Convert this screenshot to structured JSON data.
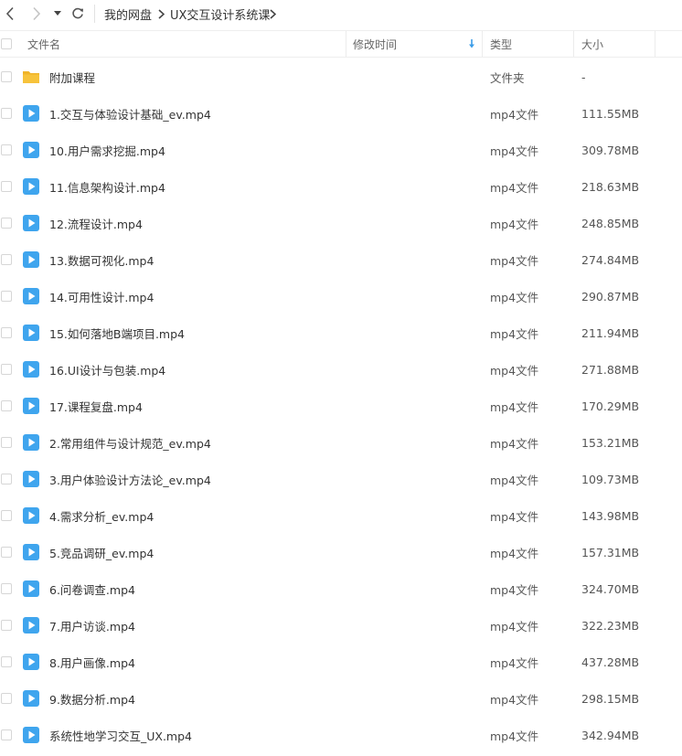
{
  "toolbar": {
    "back_icon": "chevron-left-icon",
    "forward_icon": "chevron-right-icon",
    "dropdown_icon": "caret-down-icon",
    "refresh_icon": "refresh-icon"
  },
  "breadcrumb": {
    "items": [
      "我的网盘",
      "UX交互设计系统课"
    ]
  },
  "columns": {
    "name": "文件名",
    "modified": "修改时间",
    "type": "类型",
    "size": "大小",
    "sort_icon": "sort-down-arrow-icon"
  },
  "colors": {
    "accent": "#3b9ce8",
    "folder": "#f7c33b",
    "video": "#3fa5ee"
  },
  "files": [
    {
      "name": "附加课程",
      "type": "文件夹",
      "size": "-",
      "icon": "folder-icon"
    },
    {
      "name": "1.交互与体验设计基础_ev.mp4",
      "type": "mp4文件",
      "size": "111.55MB",
      "icon": "video-file-icon"
    },
    {
      "name": "10.用户需求挖掘.mp4",
      "type": "mp4文件",
      "size": "309.78MB",
      "icon": "video-file-icon"
    },
    {
      "name": "11.信息架构设计.mp4",
      "type": "mp4文件",
      "size": "218.63MB",
      "icon": "video-file-icon"
    },
    {
      "name": "12.流程设计.mp4",
      "type": "mp4文件",
      "size": "248.85MB",
      "icon": "video-file-icon"
    },
    {
      "name": "13.数据可视化.mp4",
      "type": "mp4文件",
      "size": "274.84MB",
      "icon": "video-file-icon"
    },
    {
      "name": "14.可用性设计.mp4",
      "type": "mp4文件",
      "size": "290.87MB",
      "icon": "video-file-icon"
    },
    {
      "name": "15.如何落地B端项目.mp4",
      "type": "mp4文件",
      "size": "211.94MB",
      "icon": "video-file-icon"
    },
    {
      "name": "16.UI设计与包装.mp4",
      "type": "mp4文件",
      "size": "271.88MB",
      "icon": "video-file-icon"
    },
    {
      "name": "17.课程复盘.mp4",
      "type": "mp4文件",
      "size": "170.29MB",
      "icon": "video-file-icon"
    },
    {
      "name": "2.常用组件与设计规范_ev.mp4",
      "type": "mp4文件",
      "size": "153.21MB",
      "icon": "video-file-icon"
    },
    {
      "name": "3.用户体验设计方法论_ev.mp4",
      "type": "mp4文件",
      "size": "109.73MB",
      "icon": "video-file-icon"
    },
    {
      "name": "4.需求分析_ev.mp4",
      "type": "mp4文件",
      "size": "143.98MB",
      "icon": "video-file-icon"
    },
    {
      "name": "5.竞品调研_ev.mp4",
      "type": "mp4文件",
      "size": "157.31MB",
      "icon": "video-file-icon"
    },
    {
      "name": "6.问卷调查.mp4",
      "type": "mp4文件",
      "size": "324.70MB",
      "icon": "video-file-icon"
    },
    {
      "name": "7.用户访谈.mp4",
      "type": "mp4文件",
      "size": "322.23MB",
      "icon": "video-file-icon"
    },
    {
      "name": "8.用户画像.mp4",
      "type": "mp4文件",
      "size": "437.28MB",
      "icon": "video-file-icon"
    },
    {
      "name": "9.数据分析.mp4",
      "type": "mp4文件",
      "size": "298.15MB",
      "icon": "video-file-icon"
    },
    {
      "name": "系统性地学习交互_UX.mp4",
      "type": "mp4文件",
      "size": "342.94MB",
      "icon": "video-file-icon"
    }
  ]
}
